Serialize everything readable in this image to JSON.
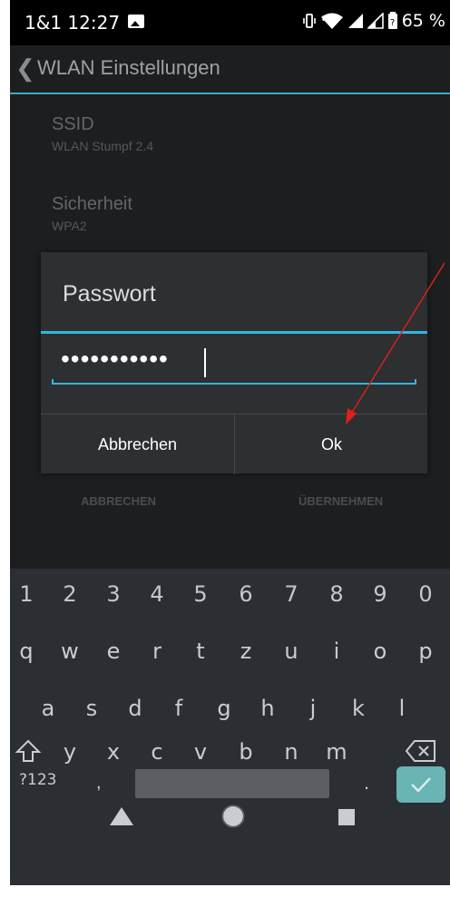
{
  "status_bar": {
    "carrier_time": "1&1  12:27",
    "battery": "65 %",
    "icons": [
      "image-notification-icon",
      "vibrate-icon",
      "wifi-icon",
      "signal-icon",
      "signal-icon-2",
      "battery-icon"
    ]
  },
  "app_bar": {
    "back_icon": "back-chevron-icon",
    "title": "WLAN Einstellungen"
  },
  "settings": [
    {
      "label": "SSID",
      "value": "WLAN Stumpf 2.4"
    },
    {
      "label": "Sicherheit",
      "value": "WPA2"
    }
  ],
  "background_actions": {
    "cancel": "ABBRECHEN",
    "apply": "ÜBERNEHMEN"
  },
  "dialog": {
    "title": "Passwort",
    "password_masked": "•••••••••••",
    "cancel_label": "Abbrechen",
    "ok_label": "Ok"
  },
  "keyboard": {
    "numbers": [
      "1",
      "2",
      "3",
      "4",
      "5",
      "6",
      "7",
      "8",
      "9",
      "0"
    ],
    "row1": [
      "q",
      "w",
      "e",
      "r",
      "t",
      "z",
      "u",
      "i",
      "o",
      "p"
    ],
    "row2": [
      "a",
      "s",
      "d",
      "f",
      "g",
      "h",
      "j",
      "k",
      "l"
    ],
    "row3": [
      "y",
      "x",
      "c",
      "v",
      "b",
      "n",
      "m"
    ],
    "symbols_key": "?123",
    "comma_key": ",",
    "period_key": ".",
    "shift_icon": "shift-icon",
    "backspace_icon": "backspace-icon",
    "enter_icon": "checkmark-icon"
  },
  "nav_bar": {
    "icons": [
      "back-triangle-icon",
      "home-circle-icon",
      "recents-square-icon"
    ]
  },
  "colors": {
    "accent": "#31b6e2",
    "enter_key": "#69b4b5",
    "annotation_arrow": "#e0201c"
  }
}
